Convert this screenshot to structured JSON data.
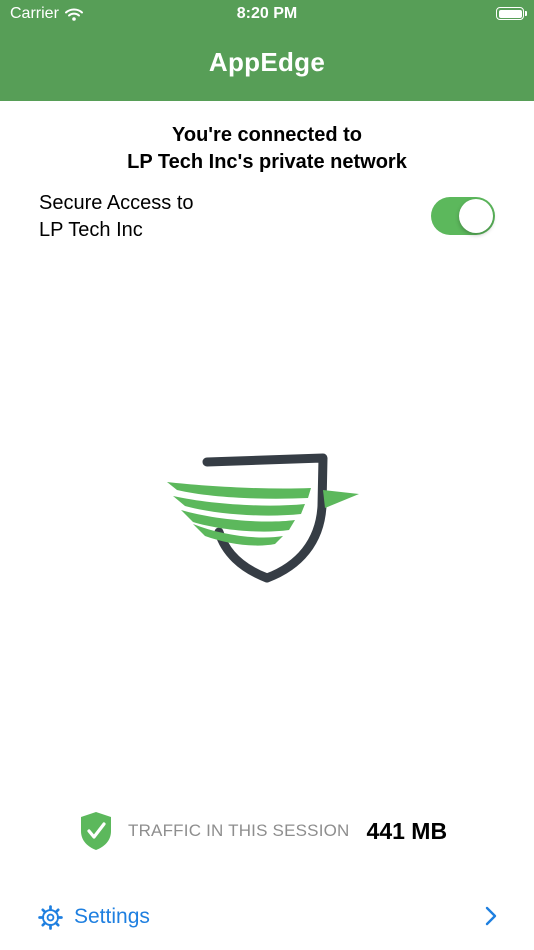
{
  "status_bar": {
    "carrier": "Carrier",
    "time": "8:20 PM",
    "battery_level": 1.0
  },
  "header": {
    "title": "AppEdge",
    "background_color": "#579e57"
  },
  "main": {
    "connected_line1": "You're connected to",
    "connected_line2": "LP Tech Inc's private network",
    "secure_access_line1": "Secure Access to",
    "secure_access_line2": "LP Tech Inc",
    "secure_access_enabled": true,
    "toggle_color": "#5cb85c"
  },
  "logo": {
    "icon": "shield-bird-logo",
    "shield_color": "#363d45",
    "wing_color": "#5cb85c"
  },
  "traffic": {
    "icon": "shield-check-icon",
    "label": "TRAFFIC IN THIS SESSION",
    "value": "441 MB"
  },
  "settings": {
    "icon": "gear-icon",
    "label": "Settings",
    "chevron": "chevron-right-icon",
    "color": "#1e7fe0"
  }
}
